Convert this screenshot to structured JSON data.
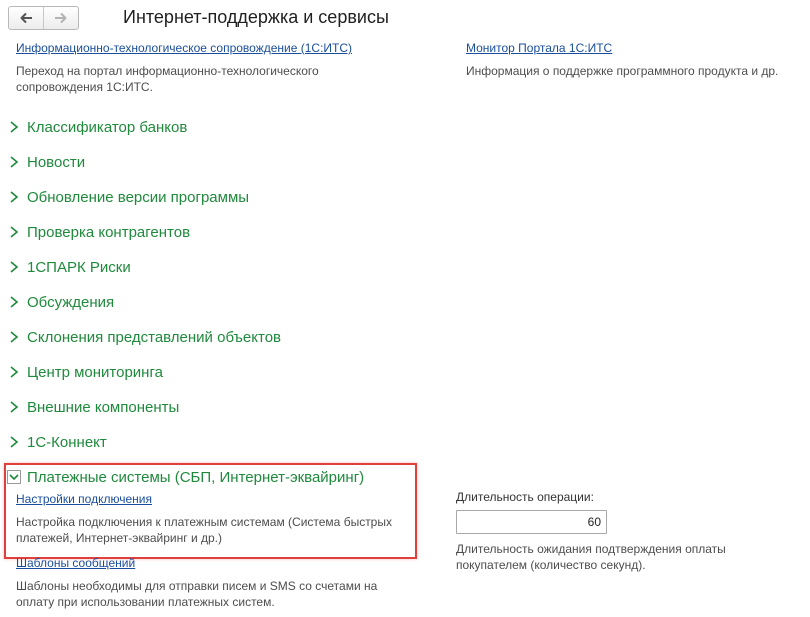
{
  "toolbar": {
    "back_icon": "arrow-left-icon",
    "forward_icon": "arrow-right-icon"
  },
  "header": {
    "title": "Интернет-поддержка и сервисы"
  },
  "top_links": [
    {
      "label": "Информационно-технологическое сопровождение (1С:ИТС)",
      "description": "Переход на портал информационно-технологического сопровождения 1С:ИТС."
    },
    {
      "label": "Монитор Портала 1С:ИТС",
      "description": "Информация о поддержке программного продукта и др."
    }
  ],
  "sections": [
    "Классификатор банков",
    "Новости",
    "Обновление версии программы",
    "Проверка контрагентов",
    "1СПАРК Риски",
    "Обсуждения",
    "Склонения представлений объектов",
    "Центр мониторинга",
    "Внешние компоненты",
    "1С-Коннект"
  ],
  "payments": {
    "title": "Платежные системы (СБП, Интернет-эквайринг)",
    "settings_link": "Настройки подключения",
    "settings_desc": "Настройка подключения к платежным системам (Система быстрых платежей, Интернет-эквайринг и др.)",
    "templates_link": "Шаблоны сообщений",
    "templates_desc": "Шаблоны необходимы для отправки писем и SMS со счетами на оплату при использовании платежных систем.",
    "duration_label": "Длительность операции:",
    "duration_value": "60",
    "duration_desc": "Длительность ожидания подтверждения оплаты покупателем (количество секунд)."
  },
  "colors": {
    "section_text": "#1f8a3c",
    "link": "#1a4e9c",
    "highlight_border": "#e0403c"
  }
}
